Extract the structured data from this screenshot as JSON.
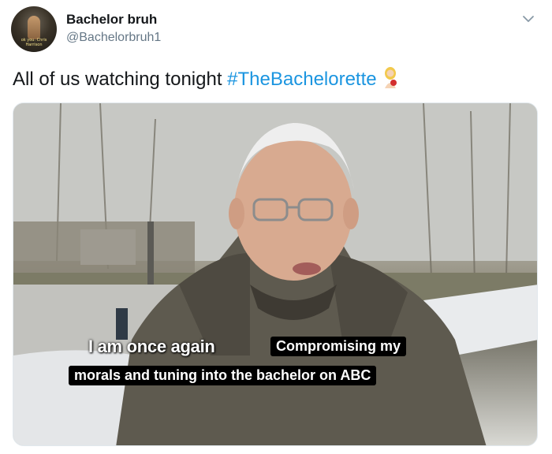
{
  "tweet": {
    "display_name": "Bachelor bruh",
    "handle": "@Bachelorbruh1",
    "avatar_caption": "ok you. Chris Harrison",
    "text_plain": "All of us watching tonight ",
    "hashtag": "#TheBachelorette"
  },
  "meme": {
    "caption_part1": "I am once again",
    "caption_part2": "Compromising my",
    "caption_part3": "morals and tuning into  the bachelor on ABC"
  },
  "icons": {
    "chevron": "chevron-down-icon",
    "emoji": "bachelorette-rose-emoji"
  },
  "colors": {
    "hashtag": "#1b95e0",
    "handle": "#657786",
    "text": "#14171a"
  }
}
